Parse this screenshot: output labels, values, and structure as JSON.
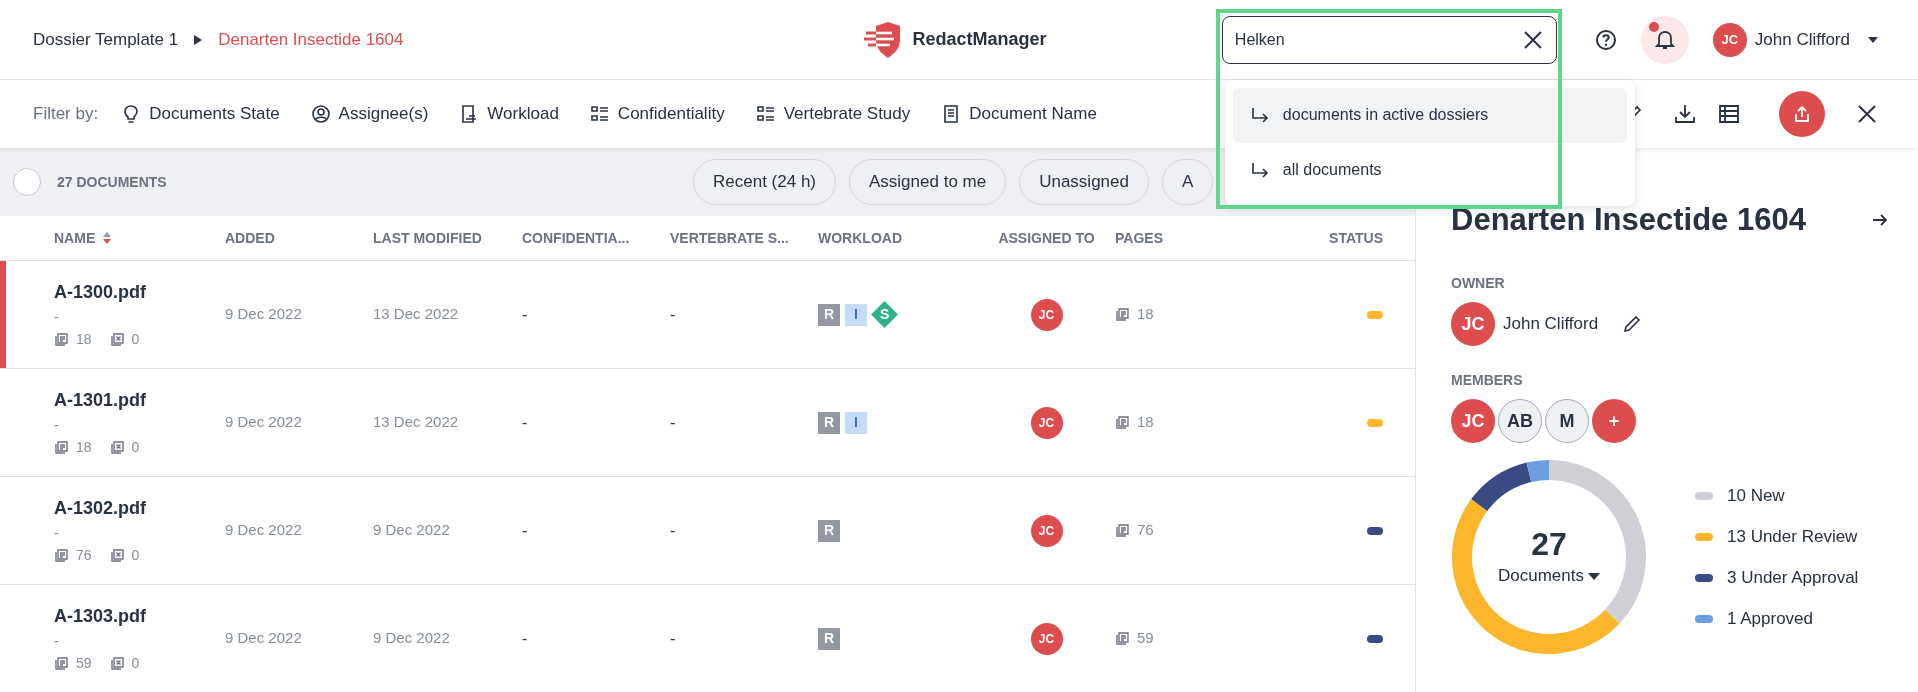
{
  "breadcrumb": [
    {
      "label": "Dossier Template 1",
      "current": false
    },
    {
      "label": "Denarten Insectide 1604",
      "current": true
    }
  ],
  "app": {
    "name": "RedactManager"
  },
  "search": {
    "value": "Helken",
    "suggestions": [
      {
        "label": "documents in active dossiers",
        "selected": true
      },
      {
        "label": "all documents",
        "selected": false
      }
    ]
  },
  "notifications": {
    "unread": true
  },
  "user": {
    "initials": "JC",
    "name": "John Clifford"
  },
  "filter_bar": {
    "label": "Filter by:",
    "filters": [
      {
        "label": "Documents State"
      },
      {
        "label": "Assignee(s)"
      },
      {
        "label": "Workload"
      },
      {
        "label": "Confidentiality"
      },
      {
        "label": "Vertebrate Study"
      },
      {
        "label": "Document Name"
      }
    ]
  },
  "toolbar": {
    "checked": false,
    "count": "27 DOCUMENTS",
    "quick_filters": [
      {
        "label": "Recent (24 h)"
      },
      {
        "label": "Assigned to me"
      },
      {
        "label": "Unassigned"
      },
      {
        "label": "A"
      }
    ]
  },
  "table": {
    "columns": [
      {
        "label": "NAME",
        "sort_descending": true
      },
      {
        "label": "ADDED"
      },
      {
        "label": "LAST MODIFIED"
      },
      {
        "label": "CONFIDENTIA..."
      },
      {
        "label": "VERTEBRATE S..."
      },
      {
        "label": "WORKLOAD"
      },
      {
        "label": "ASSIGNED TO"
      },
      {
        "label": "PAGES"
      },
      {
        "label": "STATUS"
      }
    ],
    "rows": [
      {
        "name": "A-1300.pdf",
        "subtitle": "-",
        "page_count": "18",
        "excluded_count": "0",
        "added": "9 Dec 2022",
        "modified": "13 Dec 2022",
        "confidentiality": "-",
        "vertebrate_study": "-",
        "workload": [
          {
            "kind": "dark",
            "label": "R"
          },
          {
            "kind": "light",
            "label": "I"
          },
          {
            "kind": "diamond",
            "label": "S"
          }
        ],
        "assignee": "JC",
        "pages": "18",
        "color": "#fbb62b",
        "selected": true
      },
      {
        "name": "A-1301.pdf",
        "subtitle": "-",
        "page_count": "18",
        "excluded_count": "0",
        "added": "9 Dec 2022",
        "modified": "13 Dec 2022",
        "confidentiality": "-",
        "vertebrate_study": "-",
        "workload": [
          {
            "kind": "dark",
            "label": "R"
          },
          {
            "kind": "light",
            "label": "I"
          }
        ],
        "assignee": "JC",
        "pages": "18",
        "color": "#fbb62b",
        "selected": false
      },
      {
        "name": "A-1302.pdf",
        "subtitle": "-",
        "page_count": "76",
        "excluded_count": "0",
        "added": "9 Dec 2022",
        "modified": "9 Dec 2022",
        "confidentiality": "-",
        "vertebrate_study": "-",
        "workload": [
          {
            "kind": "dark",
            "label": "R"
          }
        ],
        "assignee": "JC",
        "pages": "76",
        "color": "#3a4b84",
        "selected": false
      },
      {
        "name": "A-1303.pdf",
        "subtitle": "-",
        "page_count": "59",
        "excluded_count": "0",
        "added": "9 Dec 2022",
        "modified": "9 Dec 2022",
        "confidentiality": "-",
        "vertebrate_study": "-",
        "workload": [
          {
            "kind": "dark",
            "label": "R"
          }
        ],
        "assignee": "JC",
        "pages": "59",
        "color": "#3a4b84",
        "selected": false
      }
    ]
  },
  "panel": {
    "title": "Denarten Insectide 1604",
    "owner_label": "OWNER",
    "owner": {
      "initials": "JC",
      "name": "John Clifford"
    },
    "members_label": "MEMBERS",
    "members": [
      {
        "initials": "JC",
        "kind": "owner"
      },
      {
        "initials": "AB",
        "kind": "member"
      },
      {
        "initials": "M",
        "kind": "member"
      }
    ],
    "add_label": "+",
    "center_value": "27",
    "chart_data": {
      "type": "donut",
      "categories": [
        "10 New",
        "13 Under Review",
        "3 Under Approval",
        "1 Approved"
      ],
      "series": [
        {
          "name": "Documents",
          "values": [
            10,
            13,
            3,
            1
          ]
        }
      ]
    },
    "legend": [
      {
        "color": "#cfd0d5"
      },
      {
        "color": "#fbb62b"
      },
      {
        "color": "#3a4b84"
      },
      {
        "color": "#6b9ee0"
      }
    ]
  }
}
